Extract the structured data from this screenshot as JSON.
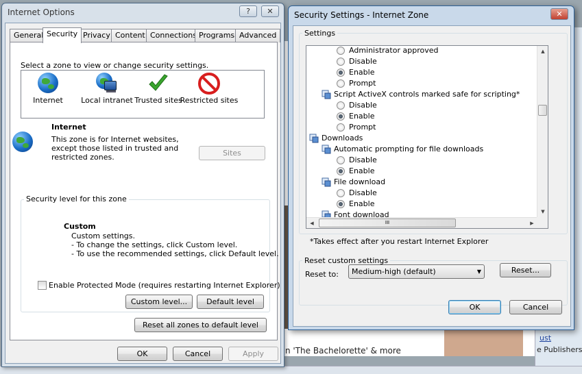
{
  "background": {
    "text_bachelorette": "n 'The Bachelorette' & more",
    "link_ust": "ust",
    "text_publishers": "e Publishers"
  },
  "internet_options": {
    "title": "Internet Options",
    "help_btn": "?",
    "close_btn": "✕",
    "tabs": [
      "General",
      "Security",
      "Privacy",
      "Content",
      "Connections",
      "Programs",
      "Advanced"
    ],
    "selected_tab": "Security",
    "zone_prompt": "Select a zone to view or change security settings.",
    "zones": [
      {
        "label": "Internet",
        "icon": "globe-icon"
      },
      {
        "label": "Local intranet",
        "icon": "intranet-icon"
      },
      {
        "label": "Trusted sites",
        "icon": "checkmark-icon"
      },
      {
        "label": "Restricted sites",
        "icon": "restricted-icon"
      }
    ],
    "selected_zone_title": "Internet",
    "selected_zone_desc": [
      "This zone is for Internet websites,",
      "except those listed in trusted and",
      "restricted zones."
    ],
    "sites_button": "Sites",
    "security_level_label": "Security level for this zone",
    "custom_title": "Custom",
    "custom_lines": [
      "Custom settings.",
      "- To change the settings, click Custom level.",
      "- To use the recommended settings, click Default level."
    ],
    "protected_mode_label": "Enable Protected Mode (requires restarting Internet Explorer)",
    "protected_mode_checked": false,
    "custom_level_button": "Custom level...",
    "default_level_button": "Default level",
    "reset_all_button": "Reset all zones to default level",
    "ok_button": "OK",
    "cancel_button": "Cancel",
    "apply_button": "Apply"
  },
  "security_settings": {
    "title": "Security Settings - Internet Zone",
    "close_btn": "✕",
    "settings_label": "Settings",
    "rows": [
      {
        "type": "radio",
        "indent": 2,
        "label": "Administrator approved",
        "checked": false
      },
      {
        "type": "radio",
        "indent": 2,
        "label": "Disable",
        "checked": false
      },
      {
        "type": "radio",
        "indent": 2,
        "label": "Enable",
        "checked": true
      },
      {
        "type": "radio",
        "indent": 2,
        "label": "Prompt",
        "checked": false
      },
      {
        "type": "setting",
        "indent": 1,
        "label": "Script ActiveX controls marked safe for scripting*"
      },
      {
        "type": "radio",
        "indent": 2,
        "label": "Disable",
        "checked": false
      },
      {
        "type": "radio",
        "indent": 2,
        "label": "Enable",
        "checked": true
      },
      {
        "type": "radio",
        "indent": 2,
        "label": "Prompt",
        "checked": false
      },
      {
        "type": "category",
        "indent": 0,
        "label": "Downloads"
      },
      {
        "type": "setting",
        "indent": 1,
        "label": "Automatic prompting for file downloads"
      },
      {
        "type": "radio",
        "indent": 2,
        "label": "Disable",
        "checked": false
      },
      {
        "type": "radio",
        "indent": 2,
        "label": "Enable",
        "checked": true
      },
      {
        "type": "setting",
        "indent": 1,
        "label": "File download"
      },
      {
        "type": "radio",
        "indent": 2,
        "label": "Disable",
        "checked": false
      },
      {
        "type": "radio",
        "indent": 2,
        "label": "Enable",
        "checked": true
      },
      {
        "type": "setting",
        "indent": 1,
        "label": "Font download"
      }
    ],
    "footnote": "*Takes effect after you restart Internet Explorer",
    "reset_group_label": "Reset custom settings",
    "reset_to_label": "Reset to:",
    "reset_to_value": "Medium-high (default)",
    "reset_button": "Reset...",
    "ok_button": "OK",
    "cancel_button": "Cancel",
    "hscroll_grip": "III"
  }
}
